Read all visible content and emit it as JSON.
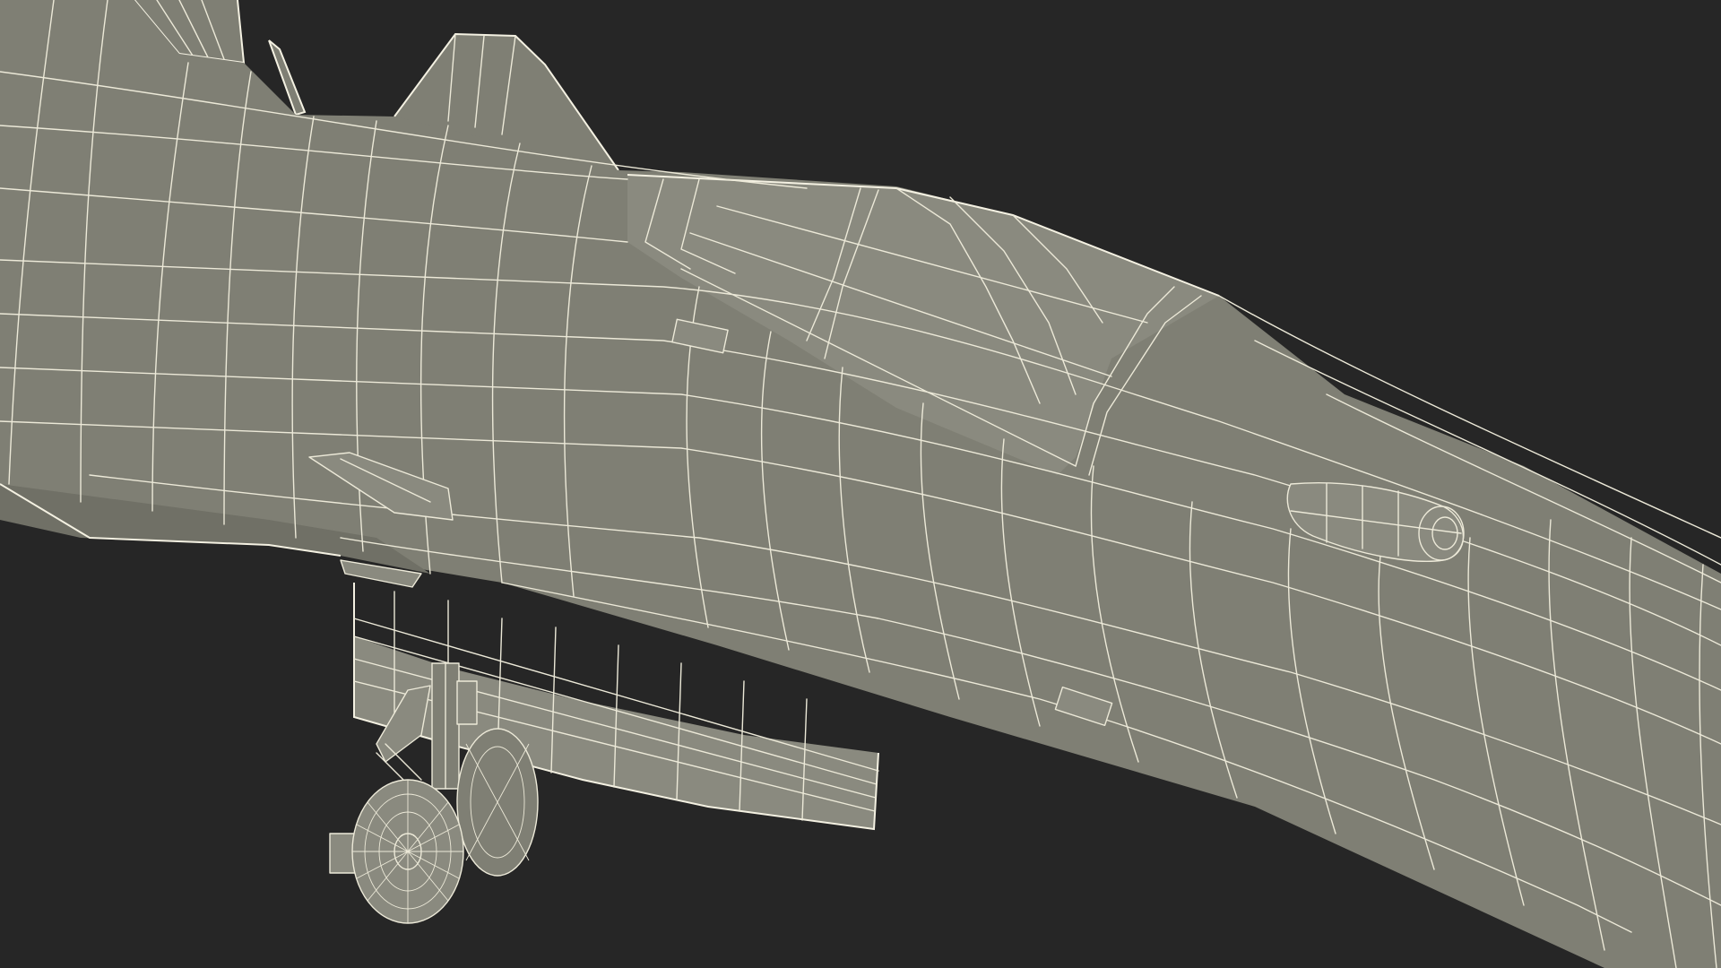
{
  "scene": {
    "subject": "aircraft-wireframe-render",
    "colors": {
      "background": "#262626",
      "surface": "#7f7f74",
      "wire": "#ece9d8"
    }
  }
}
